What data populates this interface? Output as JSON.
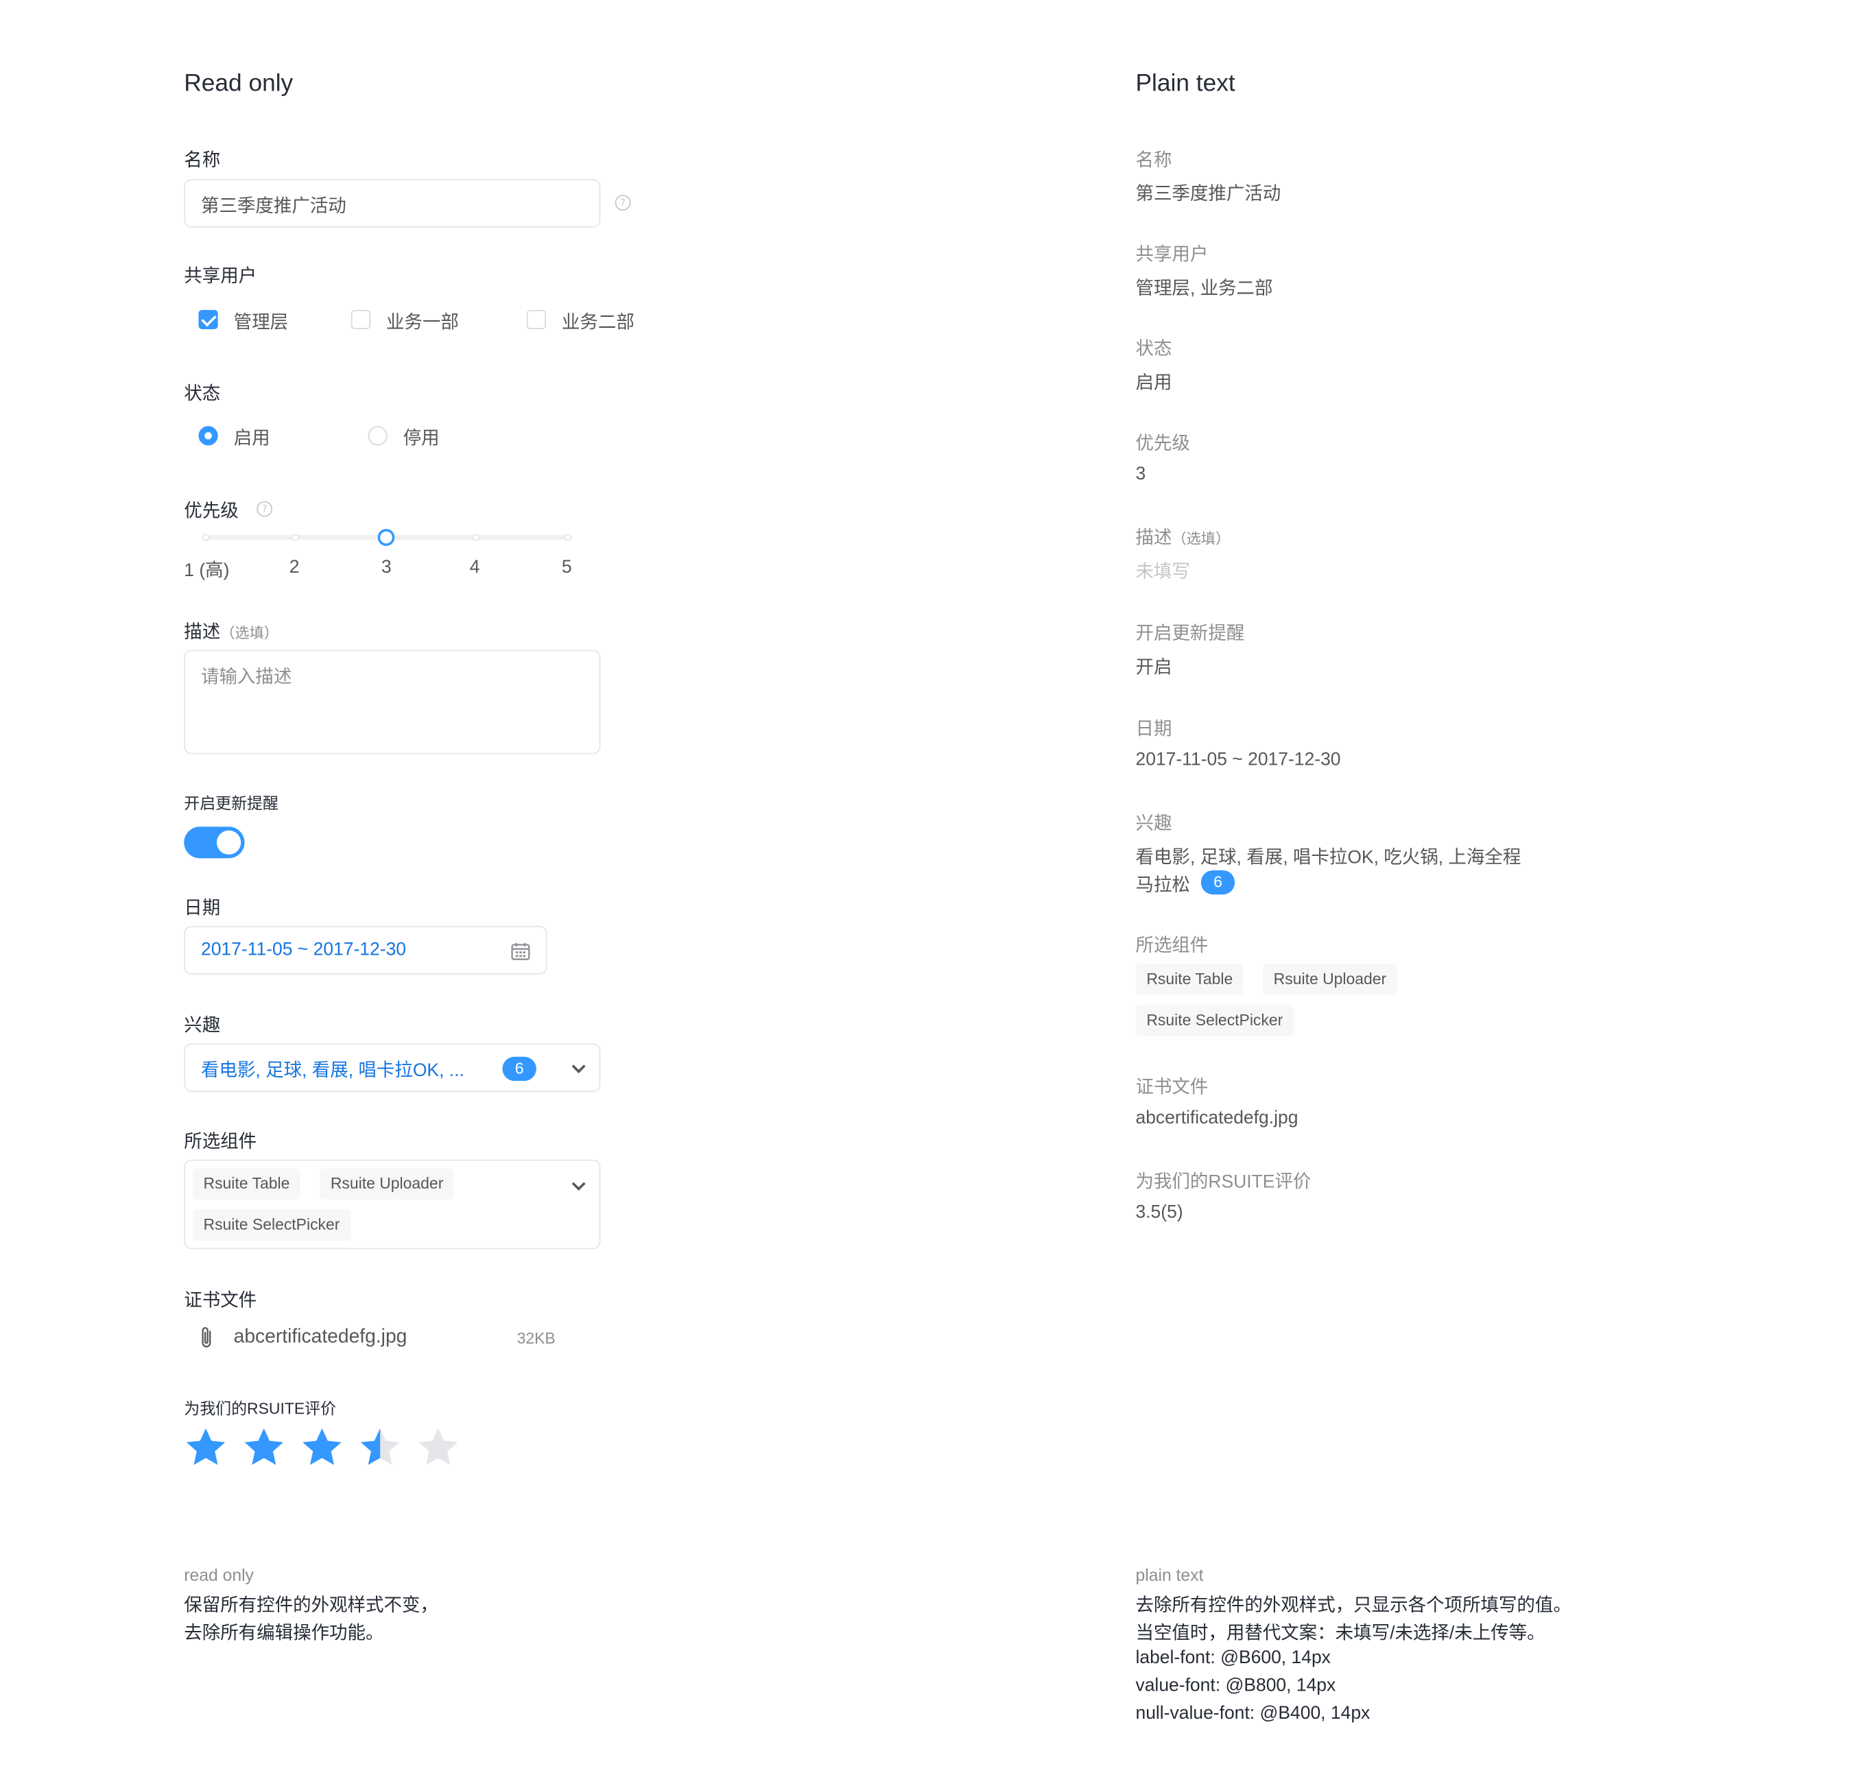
{
  "colors": {
    "primary": "#3498ff",
    "link": "#1675e0",
    "label": "#8e8e93",
    "value": "#575757",
    "null": "#c5c6c7",
    "star_off": "#e5e5ea"
  },
  "left": {
    "title": "Read only",
    "name": {
      "label": "名称",
      "value": "第三季度推广活动",
      "help_icon": "question-circle-icon"
    },
    "shared": {
      "label": "共享用户",
      "options": [
        {
          "label": "管理层",
          "checked": true
        },
        {
          "label": "业务一部",
          "checked": false
        },
        {
          "label": "业务二部",
          "checked": false
        }
      ]
    },
    "status": {
      "label": "状态",
      "options": [
        {
          "label": "启用",
          "checked": true
        },
        {
          "label": "停用",
          "checked": false
        }
      ]
    },
    "priority": {
      "label": "优先级",
      "ticks": [
        "1 (高)",
        "2",
        "3",
        "4",
        "5"
      ],
      "value": 3,
      "help_icon": "question-circle-icon"
    },
    "desc": {
      "label": "描述",
      "label_hint": "（选填）",
      "placeholder": "请输入描述"
    },
    "reminder": {
      "label": "开启更新提醒",
      "on": true
    },
    "date": {
      "label": "日期",
      "value": "2017-11-05 ~ 2017-12-30",
      "icon": "calendar-icon"
    },
    "interests": {
      "label": "兴趣",
      "value": "看电影, 足球, 看展, 唱卡拉OK, ...",
      "count": "6"
    },
    "components": {
      "label": "所选组件",
      "tags": [
        "Rsuite Table",
        "Rsuite Uploader",
        "Rsuite SelectPicker"
      ]
    },
    "file": {
      "label": "证书文件",
      "name": "abcertificatedefg.jpg",
      "size": "32KB",
      "icon": "paperclip-icon"
    },
    "rating": {
      "label": "为我们的RSUITE评价",
      "value": 3.5,
      "max": 5
    },
    "note": {
      "title": "read only",
      "lines": [
        "保留所有控件的外观样式不变，",
        "去除所有编辑操作功能。"
      ]
    }
  },
  "right": {
    "title": "Plain text",
    "fields": [
      {
        "label": "名称",
        "value": "第三季度推广活动"
      },
      {
        "label": "共享用户",
        "value": "管理层, 业务二部"
      },
      {
        "label": "状态",
        "value": "启用"
      },
      {
        "label": "优先级",
        "value": "3"
      },
      {
        "label": "描述",
        "label_hint": "（选填）",
        "value": "未填写",
        "null": true
      },
      {
        "label": "开启更新提醒",
        "value": "开启"
      },
      {
        "label": "日期",
        "value": "2017-11-05 ~ 2017-12-30"
      }
    ],
    "interests": {
      "label": "兴趣",
      "line1": "看电影, 足球, 看展, 唱卡拉OK, 吃火锅, 上海全程",
      "line2": "马拉松",
      "count": "6"
    },
    "components": {
      "label": "所选组件",
      "tags": [
        "Rsuite Table",
        "Rsuite Uploader",
        "Rsuite SelectPicker"
      ]
    },
    "file": {
      "label": "证书文件",
      "value": "abcertificatedefg.jpg"
    },
    "rating": {
      "label": "为我们的RSUITE评价",
      "value": "3.5(5)"
    },
    "note": {
      "title": "plain text",
      "lines": [
        "去除所有控件的外观样式，只显示各个项所填写的值。",
        "当空值时，用替代文案：未填写/未选择/未上传等。",
        "label-font: @B600, 14px",
        "value-font: @B800, 14px",
        "null-value-font: @B400, 14px"
      ]
    }
  }
}
